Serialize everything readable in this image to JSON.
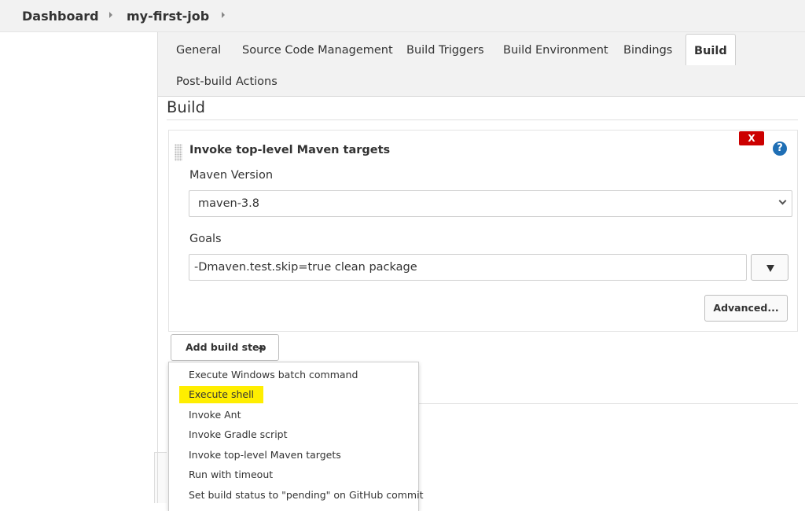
{
  "breadcrumb": {
    "items": [
      "Dashboard",
      "my-first-job"
    ]
  },
  "tabs": [
    {
      "label": "General",
      "active": false
    },
    {
      "label": "Source Code Management",
      "active": false
    },
    {
      "label": "Build Triggers",
      "active": false
    },
    {
      "label": "Build Environment",
      "active": false
    },
    {
      "label": "Bindings",
      "active": false
    },
    {
      "label": "Build",
      "active": true
    },
    {
      "label": "Post-build Actions",
      "active": false
    }
  ],
  "section": {
    "title": "Build"
  },
  "build_step": {
    "title": "Invoke top-level Maven targets",
    "delete_label": "X",
    "help_label": "?",
    "maven_version_label": "Maven Version",
    "maven_version_value": "maven-3.8",
    "goals_label": "Goals",
    "goals_value": "-Dmaven.test.skip=true clean package",
    "advanced_label": "Advanced..."
  },
  "add_build_step": {
    "label": "Add build step"
  },
  "dropdown": {
    "items": [
      "Execute Windows batch command",
      "Execute shell",
      "Invoke Ant",
      "Invoke Gradle script",
      "Invoke top-level Maven targets",
      "Run with timeout",
      "Set build status to \"pending\" on GitHub commit"
    ],
    "highlighted": "Execute shell",
    "highlight_color": "#ffee00"
  },
  "colors": {
    "delete_red": "#cc0000",
    "help_blue": "#1f6fb5"
  }
}
